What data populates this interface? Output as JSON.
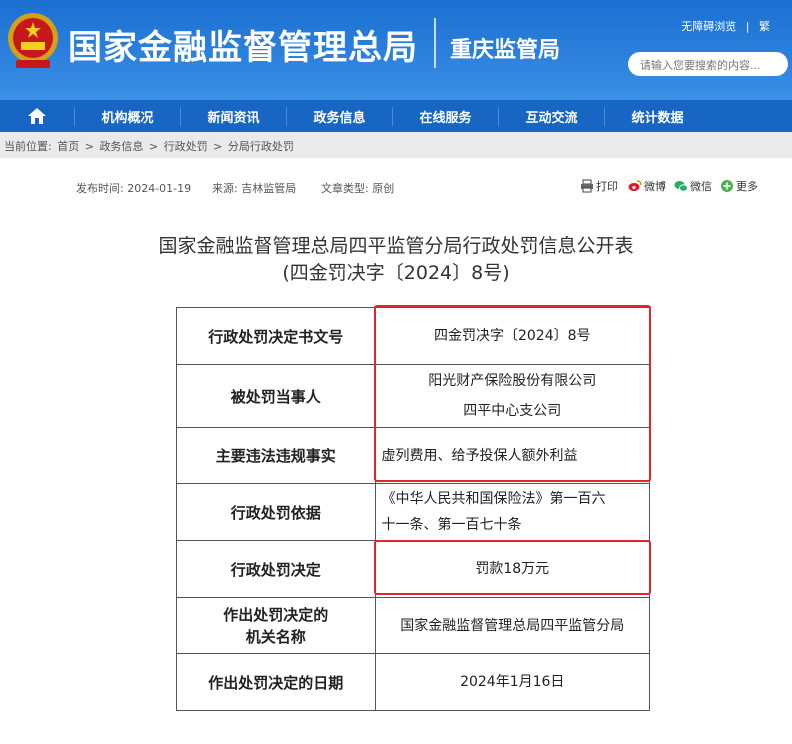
{
  "header": {
    "site_title": "国家金融监督管理总局",
    "branch": "重庆监管局",
    "top_links": [
      "无障碍浏览",
      "|",
      "繁"
    ],
    "search_placeholder": "请输入您要搜索的内容..."
  },
  "nav": {
    "items": [
      "机构概况",
      "新闻资讯",
      "政务信息",
      "在线服务",
      "互动交流",
      "统计数据"
    ]
  },
  "breadcrumb": [
    "当前位置:",
    "首页",
    ">",
    "政务信息",
    ">",
    "行政处罚",
    ">",
    "分局行政处罚"
  ],
  "meta": {
    "date": "发布时间: 2024-01-19",
    "source": "来源: 吉林监管局",
    "type": "文章类型: 原创"
  },
  "share": {
    "print": "打印",
    "weibo": "微博",
    "wechat": "微信",
    "more": "更多"
  },
  "article": {
    "title_line1": "国家金融监督管理总局四平监管分局行政处罚信息公开表",
    "title_line2": "(四金罚决字〔2024〕8号)"
  },
  "table": {
    "r1": {
      "k": "行政处罚决定书文号",
      "v": "四金罚决字〔2024〕8号"
    },
    "r2": {
      "k": "被处罚当事人",
      "v1": "阳光财产保险股份有限公司",
      "v2": "四平中心支公司"
    },
    "r3": {
      "k": "主要违法违规事实",
      "v": "虚列费用、给予投保人额外利益"
    },
    "r4": {
      "k": "行政处罚依据",
      "v1": "《中华人民共和国保险法》第一百六",
      "v2": "十一条、第一百七十条"
    },
    "r5": {
      "k": "行政处罚决定",
      "v": "罚款18万元"
    },
    "r6": {
      "k1": "作出处罚决定的",
      "k2": "机关名称",
      "v": "国家金融监督管理总局四平监管分局"
    },
    "r7": {
      "k": "作出处罚决定的日期",
      "v": "2024年1月16日"
    }
  },
  "colors": {
    "header": "#1a6fd1",
    "nav": "#1766c4",
    "highlight": "#e0282c"
  }
}
